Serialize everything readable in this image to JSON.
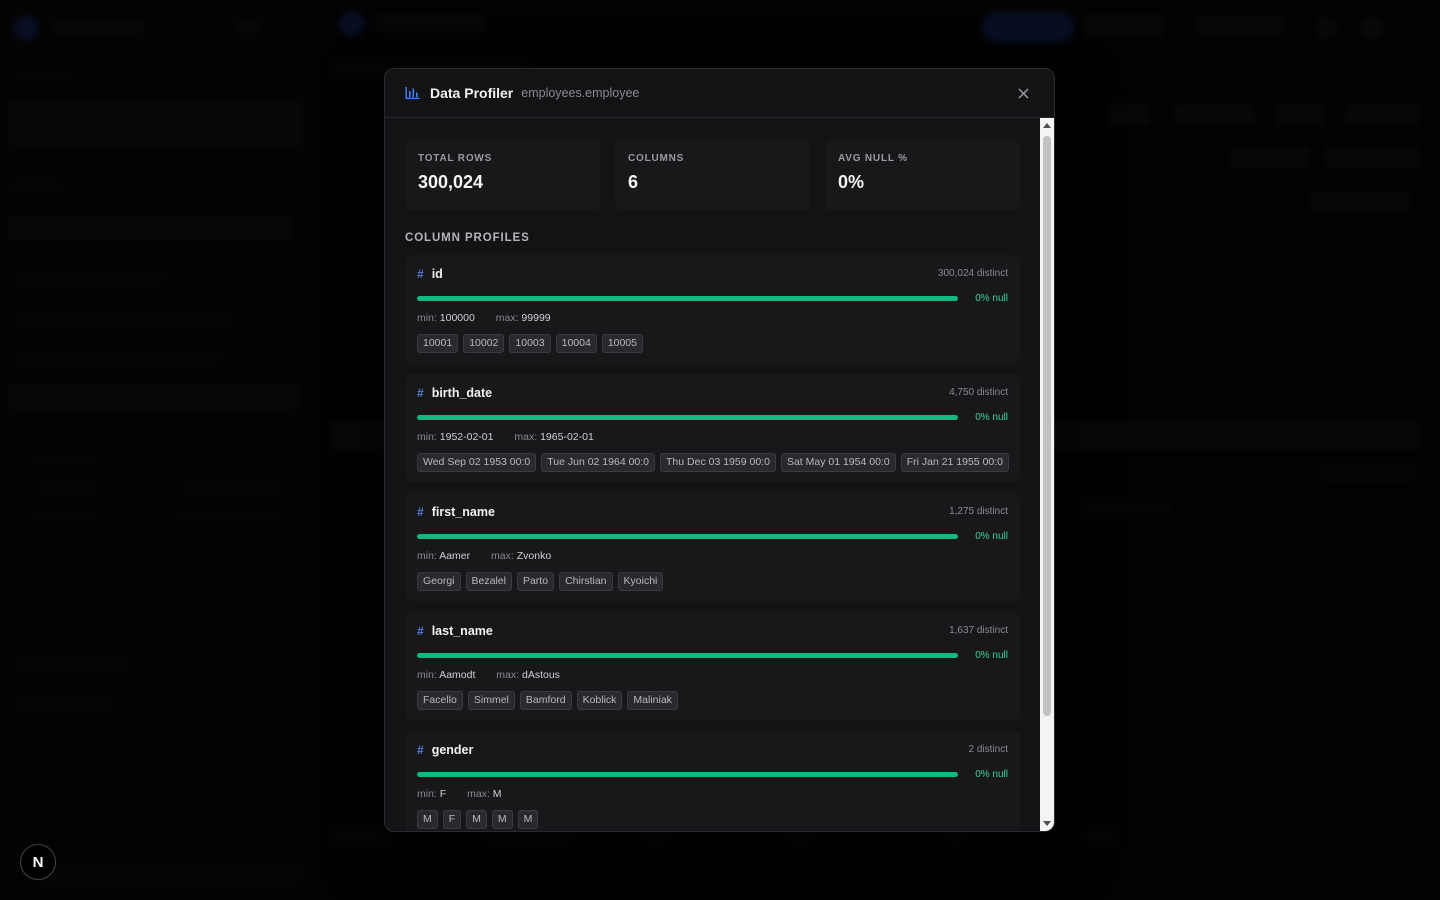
{
  "modal": {
    "title": "Data Profiler",
    "subtitle": "employees.employee",
    "close_icon": "close-icon",
    "title_icon": "bar-chart-icon"
  },
  "stats": [
    {
      "label": "TOTAL ROWS",
      "value": "300,024"
    },
    {
      "label": "COLUMNS",
      "value": "6"
    },
    {
      "label": "AVG NULL %",
      "value": "0%"
    }
  ],
  "section_title": "COLUMN PROFILES",
  "columns": [
    {
      "name": "id",
      "distinct": "300,024 distinct",
      "null": "0% null",
      "null_fraction": 0.0,
      "min_label": "min:",
      "min": "100000",
      "max_label": "max:",
      "max": "99999",
      "samples": [
        "10001",
        "10002",
        "10003",
        "10004",
        "10005"
      ]
    },
    {
      "name": "birth_date",
      "distinct": "4,750 distinct",
      "null": "0% null",
      "null_fraction": 0.0,
      "min_label": "min:",
      "min": "1952-02-01",
      "max_label": "max:",
      "max": "1965-02-01",
      "samples": [
        "Wed Sep 02 1953 00:0",
        "Tue Jun 02 1964 00:0",
        "Thu Dec 03 1959 00:0",
        "Sat May 01 1954 00:0",
        "Fri Jan 21 1955 00:0"
      ]
    },
    {
      "name": "first_name",
      "distinct": "1,275 distinct",
      "null": "0% null",
      "null_fraction": 0.0,
      "min_label": "min:",
      "min": "Aamer",
      "max_label": "max:",
      "max": "Zvonko",
      "samples": [
        "Georgi",
        "Bezalel",
        "Parto",
        "Chirstian",
        "Kyoichi"
      ]
    },
    {
      "name": "last_name",
      "distinct": "1,637 distinct",
      "null": "0% null",
      "null_fraction": 0.0,
      "min_label": "min:",
      "min": "Aamodt",
      "max_label": "max:",
      "max": "dAstous",
      "samples": [
        "Facello",
        "Simmel",
        "Bamford",
        "Koblick",
        "Maliniak"
      ]
    },
    {
      "name": "gender",
      "distinct": "2 distinct",
      "null": "0% null",
      "null_fraction": 0.0,
      "min_label": "min:",
      "min": "F",
      "max_label": "max:",
      "max": "M",
      "samples": [
        "M",
        "F",
        "M",
        "M",
        "M"
      ]
    }
  ],
  "badge": {
    "letter": "N"
  },
  "colors": {
    "accent_green": "#10b981",
    "hash_blue": "#4f7fdc",
    "modal_bg": "#131315"
  }
}
